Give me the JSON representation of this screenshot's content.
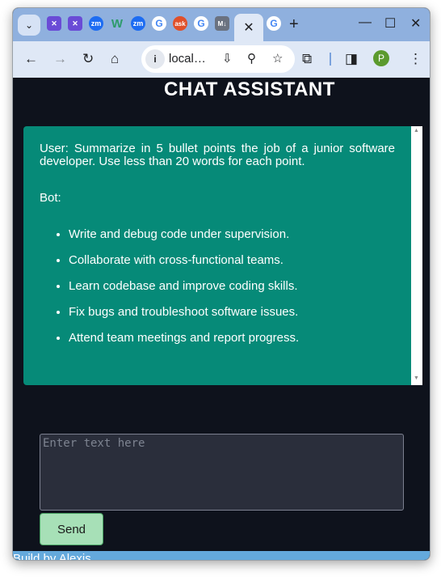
{
  "browser": {
    "tabs": [
      {
        "icon": "app-icon",
        "label": "",
        "color": "#6a4bd6"
      },
      {
        "icon": "app-icon",
        "label": "",
        "color": "#6a4bd6"
      },
      {
        "icon": "zoom-icon",
        "label": "zm",
        "color": "#1d6cf2"
      },
      {
        "icon": "webflow-icon",
        "label": "W",
        "color": "#2d9b6a"
      },
      {
        "icon": "zoom-icon",
        "label": "zm",
        "color": "#1d6cf2"
      },
      {
        "icon": "google-icon",
        "label": "G",
        "color": "#4285f4"
      },
      {
        "icon": "ask-icon",
        "label": "ask",
        "color": "#e0502a"
      },
      {
        "icon": "google-icon",
        "label": "G",
        "color": "#4285f4"
      },
      {
        "icon": "markdown-icon",
        "label": "M↓",
        "color": "#6b7280"
      }
    ],
    "active_tab_close": "✕",
    "last_tab_icon": "G",
    "new_tab": "+",
    "url": "local…",
    "profile_initial": "P"
  },
  "page": {
    "title": "CHAT ASSISTANT",
    "user_message": "User: Summarize in 5 bullet points the job of a junior software developer. Use less than 20 words for each point.",
    "bot_label": "Bot:",
    "bot_points": [
      "Write and debug code under supervision.",
      "Collaborate with cross-functional teams.",
      "Learn codebase and improve coding skills.",
      "Fix bugs and troubleshoot software issues.",
      "Attend team meetings and report progress."
    ],
    "input_placeholder": "Enter text here",
    "send_label": "Send",
    "footer": "Build by Alexis"
  },
  "colors": {
    "page_bg": "#0e121c",
    "chat_bg": "#068a78",
    "send_bg": "#a7e0b7",
    "footer_bg": "#64a9dc"
  }
}
